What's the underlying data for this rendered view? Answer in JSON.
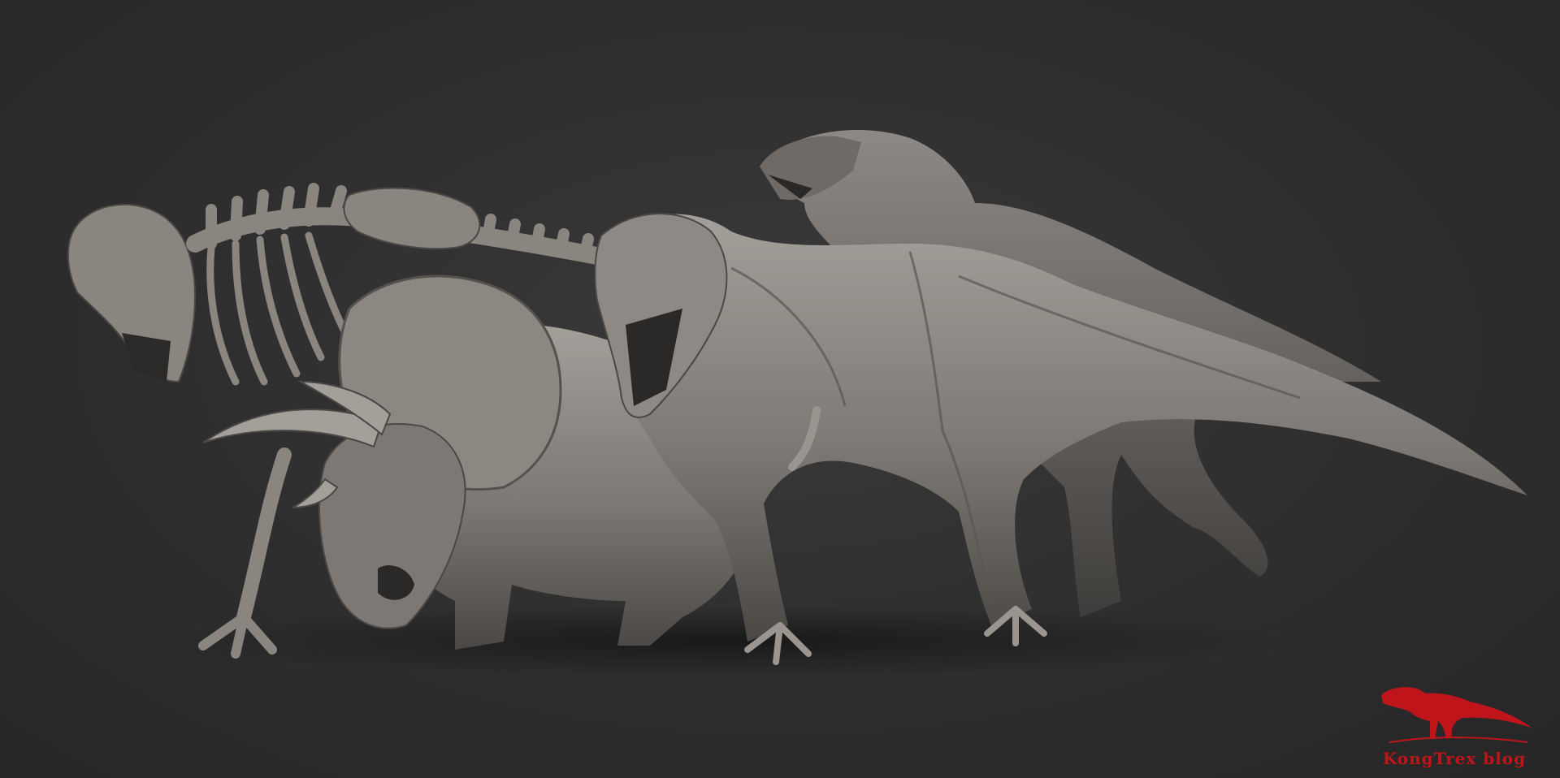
{
  "image": {
    "background_color": "#2e2e2e",
    "sculpt_color": "#7d7873",
    "sculpt_highlight": "#a49f99",
    "sculpt_shadow": "#4a4744",
    "subjects": [
      "trex-skeleton",
      "triceratops",
      "trex-muscle-study",
      "trex-skinned"
    ]
  },
  "watermark": {
    "text": "KongTrex blog",
    "color": "#c0141b"
  }
}
